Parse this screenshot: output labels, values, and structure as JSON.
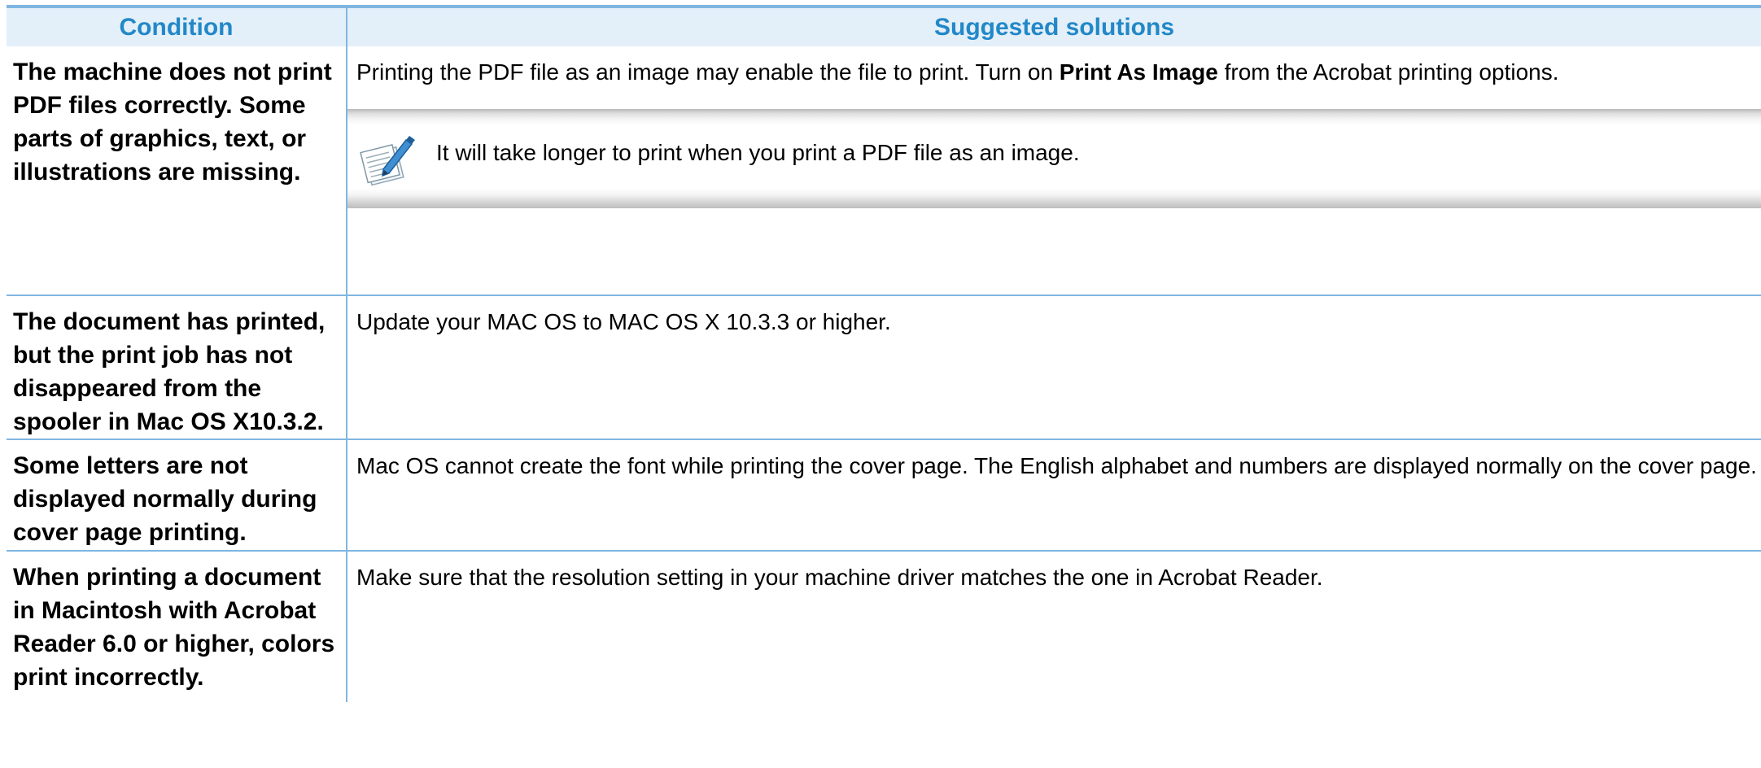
{
  "table": {
    "headers": {
      "condition": "Condition",
      "solutions": "Suggested solutions"
    },
    "rows": [
      {
        "condition": "The machine does not print PDF files correctly. Some parts of graphics, text, or illustrations are missing.",
        "solution_pre": "Printing the PDF file as an image may enable the file to print. Turn on ",
        "solution_bold": "Print As Image",
        "solution_post": " from the Acrobat printing options.",
        "note": {
          "icon": "note-pencil-icon",
          "text": "It will take longer to print when you print a PDF file as an image."
        }
      },
      {
        "condition": "The document has printed, but the print job has not disappeared from the spooler in Mac OS X10.3.2.",
        "solution": "Update your MAC OS to MAC OS X 10.3.3 or higher."
      },
      {
        "condition": "Some letters are not displayed normally during cover page printing.",
        "solution": "Mac OS cannot create the font while printing the cover page. The English alphabet and numbers are displayed normally on the cover page."
      },
      {
        "condition": "When printing a document in Macintosh with Acrobat Reader 6.0 or higher, colors print incorrectly.",
        "solution": "Make sure that the resolution setting in your machine driver matches the one in Acrobat Reader."
      }
    ]
  },
  "colors": {
    "header_text": "#2288c8",
    "header_bg": "#e3eff9",
    "rule": "#7fb6e1"
  }
}
